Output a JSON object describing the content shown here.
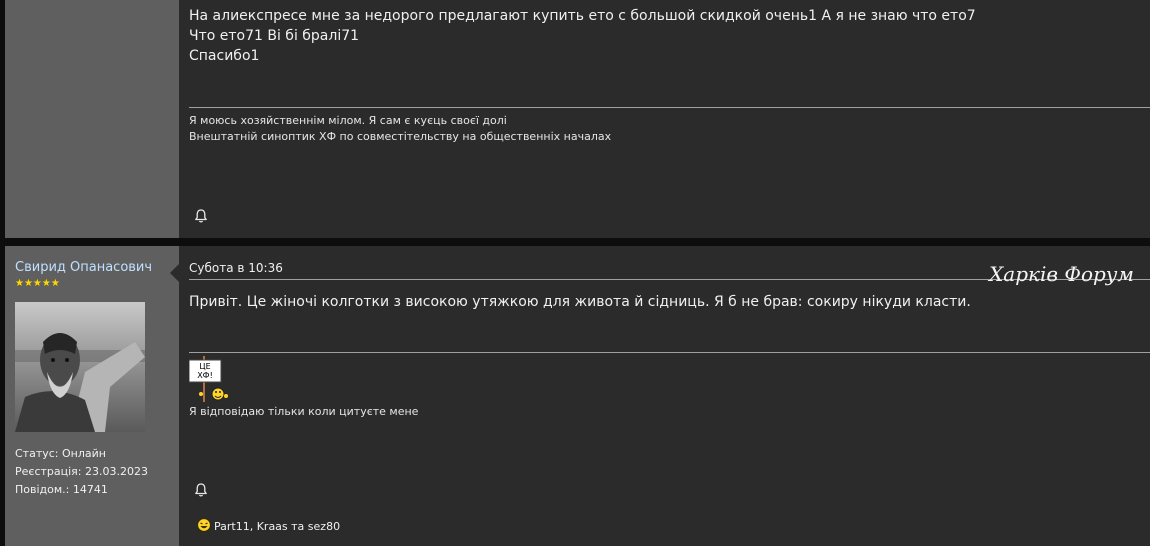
{
  "post1": {
    "message_lines": [
      "На алиекспресе мне за недорого предлагают купить ето с большой скидкой очень1 А я не знаю что ето7",
      "Что ето71 Ві бі бралі71",
      "Спасибо1"
    ],
    "signature_lines": [
      "Я моюсь хозяйственнім мілом. Я сам є куєць своєї долі",
      "Внештатній синоптик ХФ по совместітельству на общественніх началах"
    ],
    "bell_icon": "bell-icon"
  },
  "post2": {
    "author": {
      "name": "Свирид Опанасович",
      "stars": "★★★★★",
      "status": "Статус: Онлайн",
      "registered": "Реєстрація: 23.03.2023",
      "posts": "Повідом.: 14741"
    },
    "date": "Субота в 10:36",
    "message": "Привіт. Це жіночі колготки з високою утяжкою для живота й сідниць. Я б не брав: сокиру нікуди класти.",
    "signature_image": {
      "sign_text_1": "ЦЕ",
      "sign_text_2": "ХФ!"
    },
    "signature_text": "Я відповідаю тільки коли цитуєте мене",
    "likes": "Part11, Kraas та sez80",
    "bell_icon": "bell-icon"
  },
  "forum_logo": "Харків Форум",
  "colors": {
    "sidebar": "#5f5f5f",
    "content": "#2b2b2b",
    "author_name": "#bfe0ff",
    "stars": "#ffd700"
  }
}
